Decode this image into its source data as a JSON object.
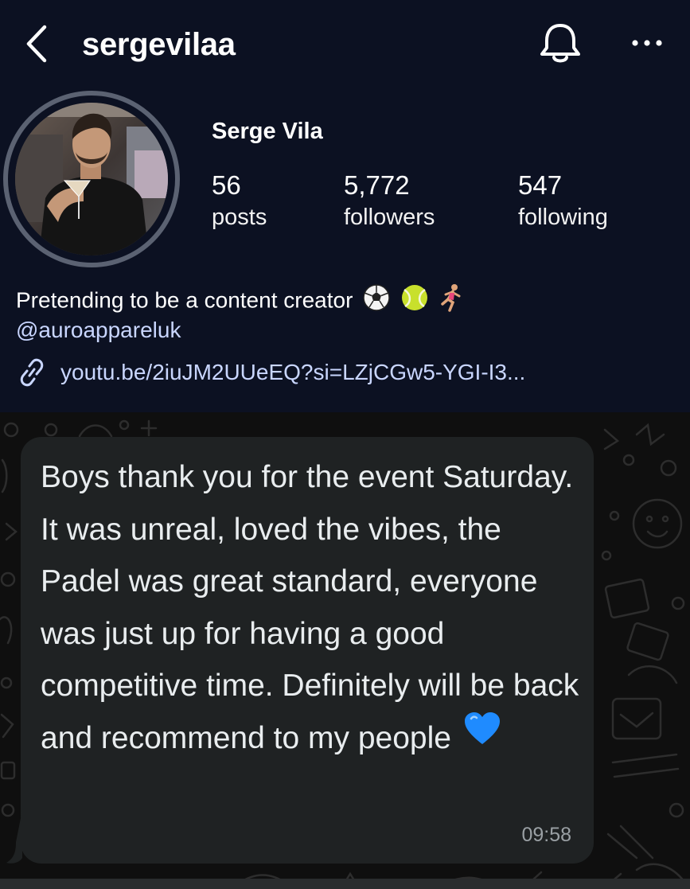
{
  "profile": {
    "username": "sergevilaa",
    "display_name": "Serge Vila",
    "stats": {
      "posts": {
        "value": "56",
        "label": "posts"
      },
      "followers": {
        "value": "5,772",
        "label": "followers"
      },
      "following": {
        "value": "547",
        "label": "following"
      }
    },
    "bio": "Pretending to be a content creator",
    "bio_emojis": [
      "soccer-ball-icon",
      "tennis-ball-icon",
      "runner-icon"
    ],
    "mention": "@auroappareluk",
    "link": "youtu.be/2iuJM2UUeEQ?si=LZjCGw5-YGI-I3..."
  },
  "icons": {
    "back": "chevron-left-icon",
    "notifications": "bell-icon",
    "more": "more-dots-icon",
    "link": "link-icon"
  },
  "message": {
    "text": "Boys thank you for the event Saturday. It was unreal, loved the vibes, the Padel was great standard, everyone was just up for having a good competitive time. Definitely will be back and recommend to my people",
    "emoji": "blue-heart-icon",
    "time": "09:58"
  },
  "colors": {
    "profile_bg": "#0c1122",
    "link_blue": "#c9d6ff",
    "chat_bg": "#0f0f0f",
    "bubble_bg": "#1f2223",
    "heart_blue": "#1f8bff"
  }
}
